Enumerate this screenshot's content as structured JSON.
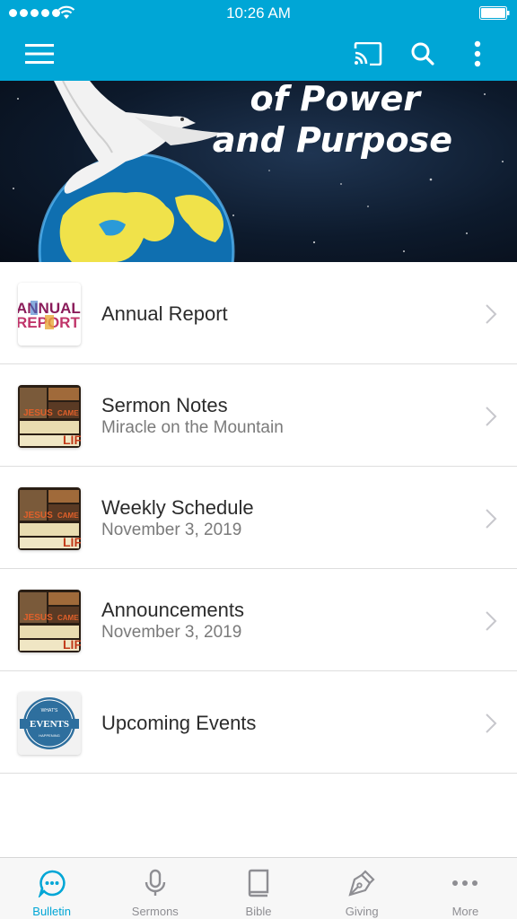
{
  "status_bar": {
    "time": "10:26 AM"
  },
  "app_bar": {
    "menu_icon": "hamburger-menu-icon",
    "cast_icon": "cast-icon",
    "search_icon": "search-icon",
    "more_icon": "more-vertical-icon"
  },
  "banner": {
    "line1": "of Power",
    "line2": "and Purpose"
  },
  "list": [
    {
      "title": "Annual Report",
      "subtitle": "",
      "thumb": "annual-report"
    },
    {
      "title": "Sermon Notes",
      "subtitle": "Miracle on the Mountain",
      "thumb": "jesus-came"
    },
    {
      "title": "Weekly Schedule",
      "subtitle": "November 3, 2019",
      "thumb": "jesus-came"
    },
    {
      "title": "Announcements",
      "subtitle": "November 3, 2019",
      "thumb": "jesus-came"
    },
    {
      "title": "Upcoming Events",
      "subtitle": "",
      "thumb": "events"
    }
  ],
  "thumb_text": {
    "annual": "ANNUAL",
    "report": "REPORT",
    "jesus": "JESUS",
    "came": "CAME",
    "life": "LIF",
    "events_top": "WHAT'S",
    "events": "EVENTS",
    "events_bottom": "HAPPENING"
  },
  "tabs": [
    {
      "label": "Bulletin",
      "icon": "chat-bubble-icon",
      "active": true
    },
    {
      "label": "Sermons",
      "icon": "microphone-icon",
      "active": false
    },
    {
      "label": "Bible",
      "icon": "book-icon",
      "active": false
    },
    {
      "label": "Giving",
      "icon": "pen-icon",
      "active": false
    },
    {
      "label": "More",
      "icon": "more-horizontal-icon",
      "active": false
    }
  ],
  "colors": {
    "accent": "#00a6d6",
    "inactive": "#8e8e93"
  }
}
